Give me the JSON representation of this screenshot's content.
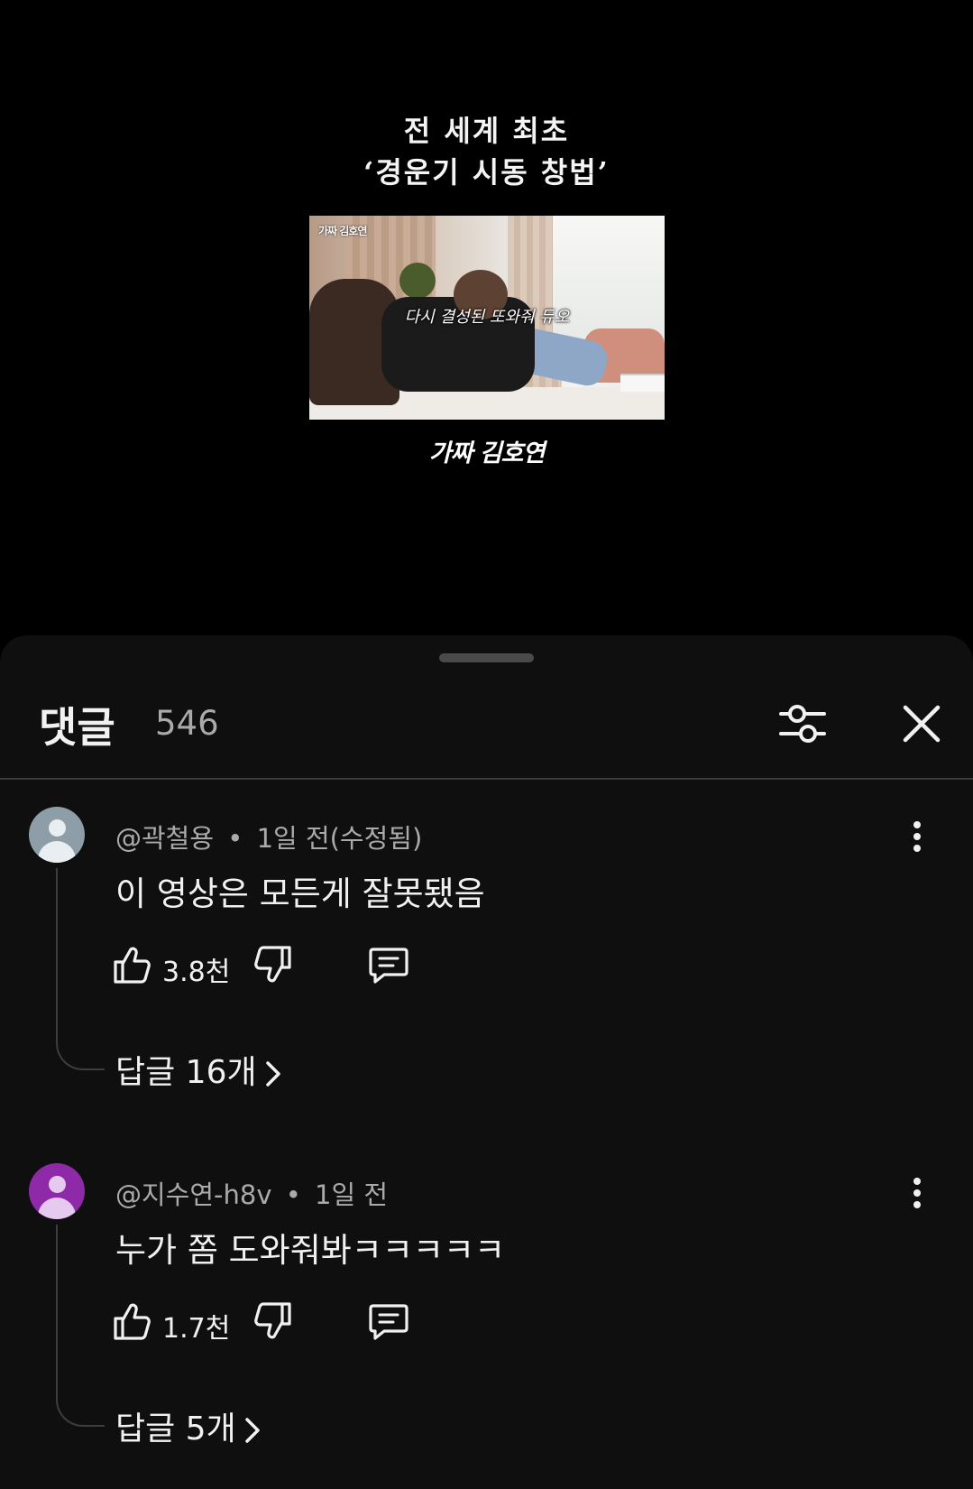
{
  "video": {
    "title_line1": "전 세계 최초",
    "title_line2": "‘경운기 시동 창법’",
    "thumbnail_watermark": "가짜 김호연",
    "thumbnail_caption": "다시 결성된 또와줘 듀오",
    "channel_logo": "가짜 김호연"
  },
  "comments_header": {
    "title": "댓글",
    "count": "546",
    "filter_icon": "sliders-icon",
    "close_icon": "close-icon"
  },
  "comments": [
    {
      "author": "@곽철용",
      "separator": "•",
      "time": "1일 전(수정됨)",
      "text": "이 영상은 모든게 잘못됐음",
      "likes": "3.8천",
      "replies": "답글 16개",
      "avatar_color": "#8e9ea8",
      "avatar_fg": "#e9eef1"
    },
    {
      "author": "@지수연-h8v",
      "separator": "•",
      "time": "1일 전",
      "text": "누가 쫌 도와줘봐ㅋㅋㅋㅋㅋ",
      "likes": "1.7천",
      "replies": "답글 5개",
      "avatar_color": "#8e2aa8",
      "avatar_fg": "#e6c9ee"
    }
  ]
}
